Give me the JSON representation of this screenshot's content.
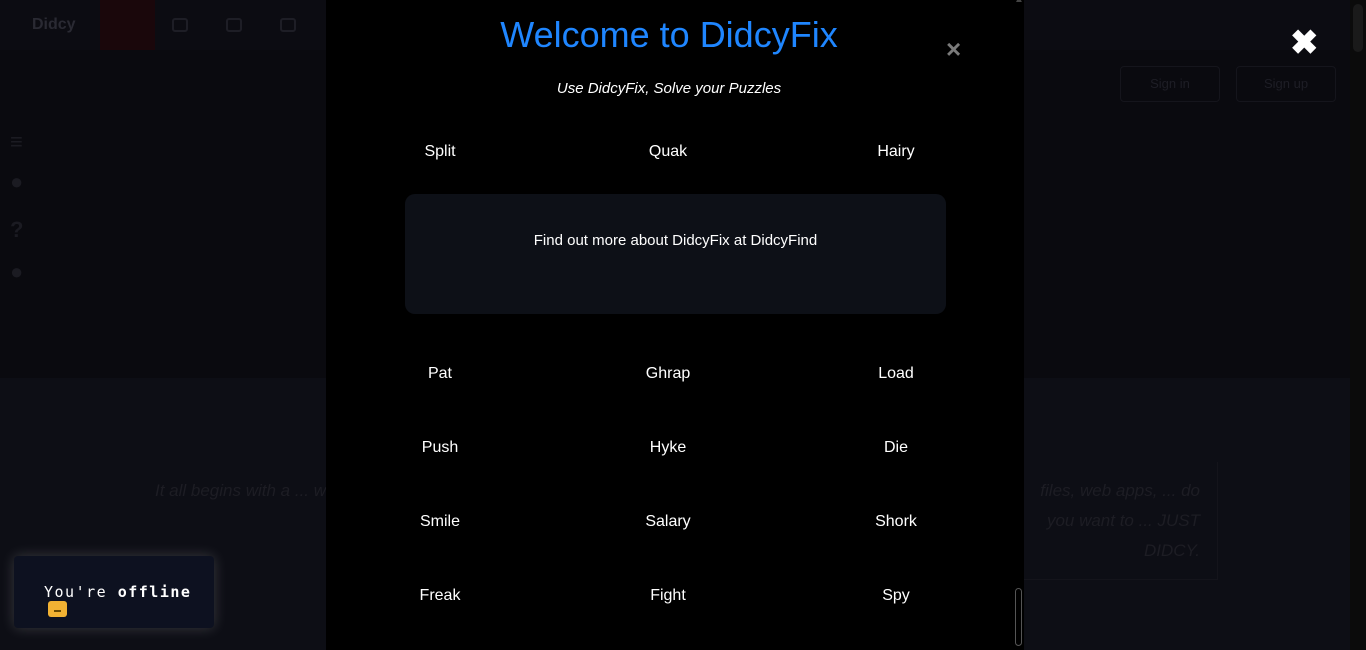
{
  "background": {
    "brand": "Didcy",
    "sign_in_label": "Sign in",
    "sign_up_label": "Sign up",
    "paragraph_left": "It all begins with a ... websites and more ... would sell, buy, host ...",
    "paragraph_right": "files, web apps, ... do you want to ... JUST DIDCY."
  },
  "modal": {
    "title": "Welcome to DidcyFix",
    "subtitle": "Use DidcyFix, Solve your Puzzles",
    "close_label": "×",
    "row1": [
      "Split",
      "Quak",
      "Hairy"
    ],
    "find_text": "Find out more about DidcyFix at DidcyFind",
    "row2": [
      "Pat",
      "Ghrap",
      "Load"
    ],
    "row3": [
      "Push",
      "Hyke",
      "Die"
    ],
    "row4": [
      "Smile",
      "Salary",
      "Shork"
    ],
    "row5": [
      "Freak",
      "Fight",
      "Spy"
    ]
  },
  "overlay_close_label": "✖",
  "toast": {
    "prefix": "You're ",
    "bold": "offline",
    "emoji": "emoji-icon"
  },
  "colors": {
    "accent": "#1f86ff",
    "modal_bg": "#000000",
    "find_box_bg": "#0d1017",
    "toast_bg": "#0d1120"
  }
}
